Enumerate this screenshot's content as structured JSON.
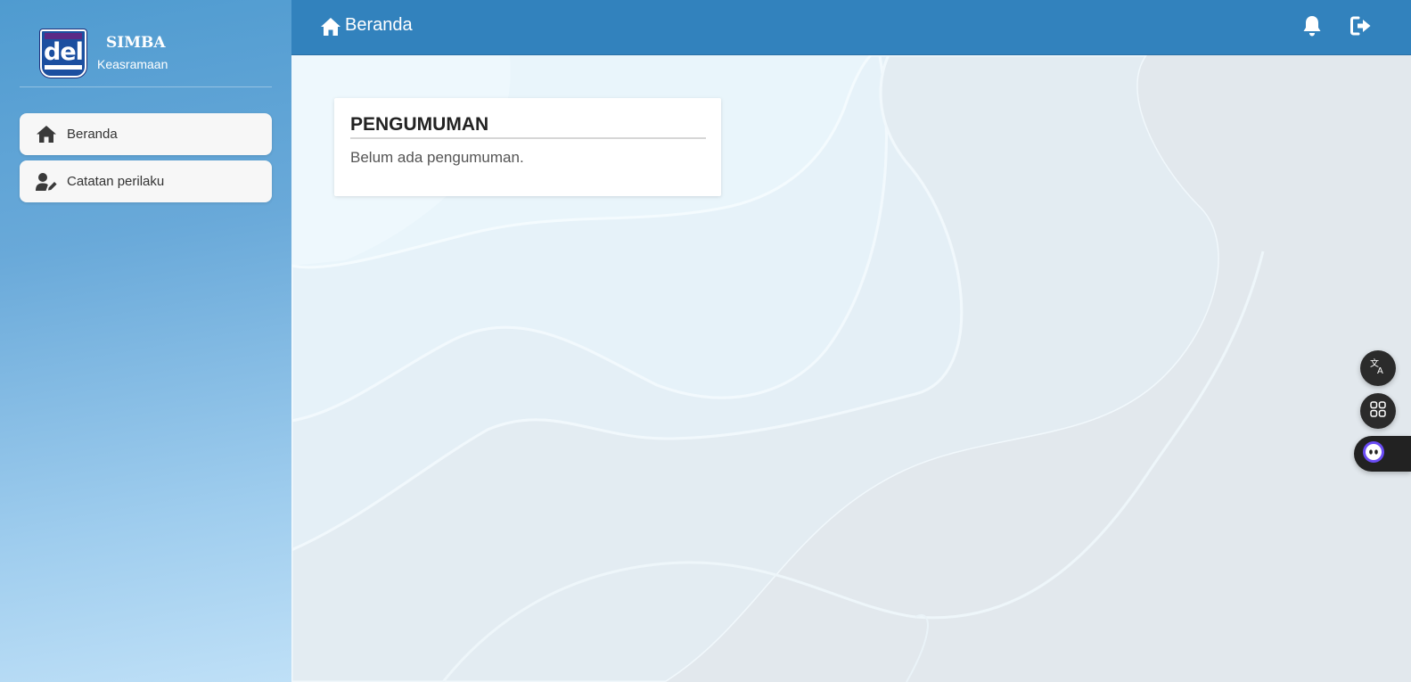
{
  "brand": {
    "logo_text": "del",
    "name": "SIMBA",
    "subtitle": "Keasramaan"
  },
  "sidebar": {
    "items": [
      {
        "label": "Beranda",
        "icon": "home-icon"
      },
      {
        "label": "Catatan perilaku",
        "icon": "user-edit-icon"
      }
    ]
  },
  "topbar": {
    "title": "Beranda",
    "icons": [
      "home-icon",
      "bell-icon",
      "logout-icon"
    ]
  },
  "announcement": {
    "title": "PENGUMUMAN",
    "message": "Belum ada pengumuman."
  },
  "floating_widgets": [
    "translate-icon",
    "apps-grid-icon",
    "assistant-icon"
  ],
  "colors": {
    "topbar": "#3282bd",
    "sidebar_top": "#4f9bd0",
    "sidebar_bottom": "#bfe0f7",
    "card": "#ffffff"
  }
}
